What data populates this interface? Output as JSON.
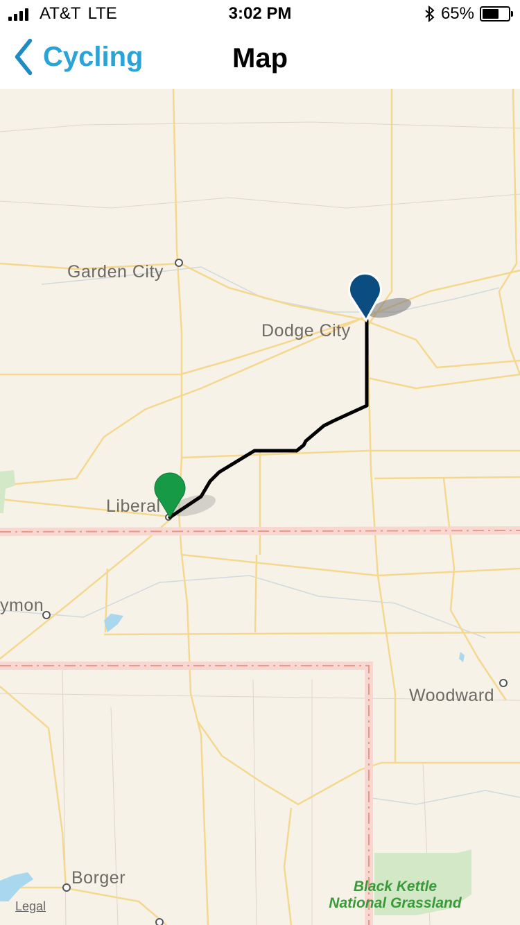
{
  "status_bar": {
    "carrier": "AT&T",
    "network": "LTE",
    "time": "3:02 PM",
    "battery": "65%",
    "battery_level": 0.65,
    "bluetooth_icon": "bluetooth-icon"
  },
  "nav": {
    "back_label": "Cycling",
    "title": "Map"
  },
  "map": {
    "cities": {
      "garden_city": "Garden City",
      "dodge_city": "Dodge City",
      "liberal": "Liberal",
      "guymon": "ymon",
      "woodward": "Woodward",
      "borger": "Borger"
    },
    "park": {
      "line1": "Black Kettle",
      "line2": "National Grassland"
    },
    "legal": "Legal",
    "markers": {
      "start": "green-pin",
      "end": "blue-pin"
    },
    "colors": {
      "route": "#000000",
      "start_pin": "#179a45",
      "end_pin": "#0b4d80",
      "background": "#f7f2e8",
      "road": "#f4d48a",
      "border": "#f0b4a8"
    }
  }
}
